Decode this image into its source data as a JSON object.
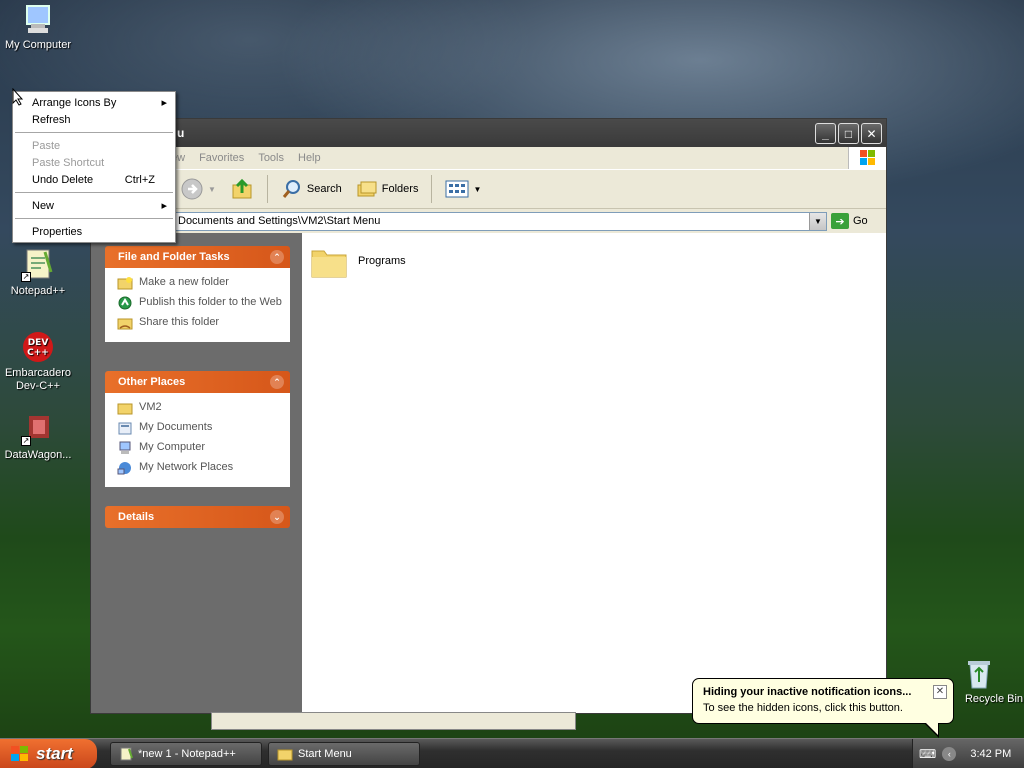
{
  "desktop": {
    "icons": [
      {
        "label": "My Computer"
      },
      {
        "label": "Notepad++"
      },
      {
        "label": "Embarcadero Dev-C++"
      },
      {
        "label": "DataWagon..."
      },
      {
        "label": "Recycle Bin"
      }
    ]
  },
  "context_menu": {
    "items": [
      {
        "label": "Arrange Icons By",
        "submenu": true
      },
      {
        "label": "Refresh"
      },
      {
        "label": "Paste",
        "disabled": true
      },
      {
        "label": "Paste Shortcut",
        "disabled": true
      },
      {
        "label": "Undo Delete",
        "shortcut": "Ctrl+Z"
      },
      {
        "label": "New",
        "submenu": true
      },
      {
        "label": "Properties"
      }
    ]
  },
  "window": {
    "title": "u",
    "menu": [
      "ew",
      "Favorites",
      "Tools",
      "Help"
    ],
    "toolbar": {
      "search_label": "Search",
      "folders_label": "Folders"
    },
    "address": {
      "value": "Documents and Settings\\VM2\\Start Menu",
      "go_label": "Go"
    },
    "tasks_panel": {
      "title": "File and Folder Tasks",
      "items": [
        "Make a new folder",
        "Publish this folder to the Web",
        "Share this folder"
      ]
    },
    "places_panel": {
      "title": "Other Places",
      "items": [
        "VM2",
        "My Documents",
        "My Computer",
        "My Network Places"
      ]
    },
    "details_panel": {
      "title": "Details"
    },
    "content": {
      "items": [
        {
          "label": "Programs"
        }
      ]
    }
  },
  "balloon": {
    "title": "Hiding your inactive notification icons...",
    "text": "To see the hidden icons, click this button."
  },
  "taskbar": {
    "start_label": "start",
    "tasks": [
      "*new 1 - Notepad++",
      "Start Menu"
    ],
    "clock": "3:42 PM"
  },
  "colors": {
    "panel_header": "#e8702a",
    "taskbar": "#2f2f2f",
    "start": "#f07030"
  }
}
